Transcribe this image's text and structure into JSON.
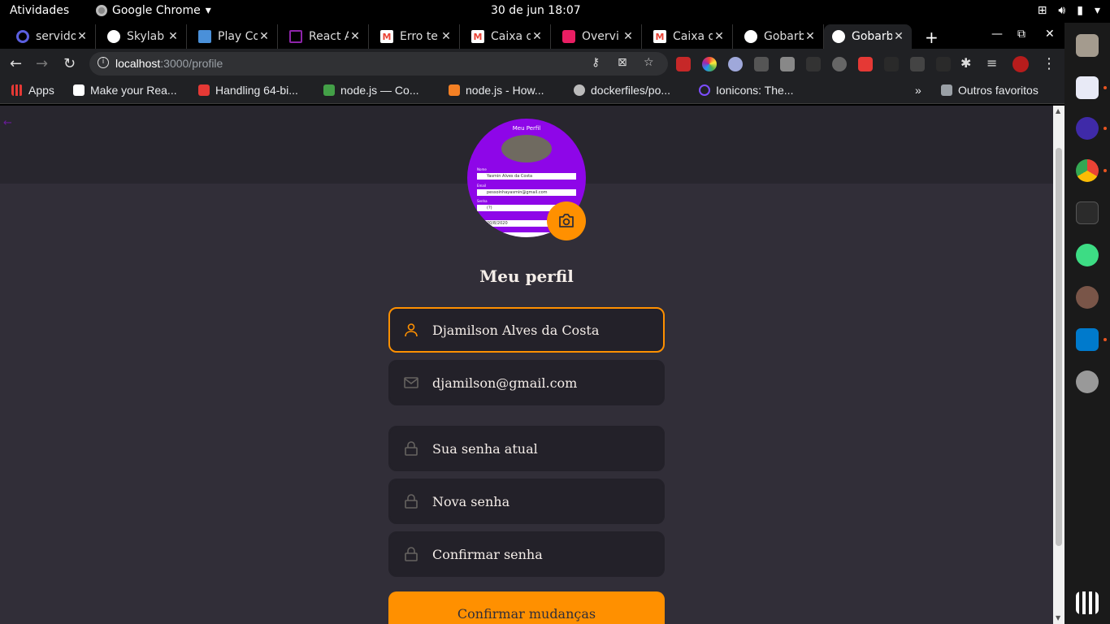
{
  "system": {
    "activities": "Atividades",
    "app_name": "Google Chrome",
    "clock": "30 de jun  18:07"
  },
  "tabs": [
    {
      "title": "servido",
      "color": "#5b5fe0"
    },
    {
      "title": "Skylab",
      "color": "#ffffff"
    },
    {
      "title": "Play Co",
      "color": "#4a90d9"
    },
    {
      "title": "React A",
      "color": "#8e24aa"
    },
    {
      "title": "Erro te",
      "color": "#ea4335"
    },
    {
      "title": "Caixa d",
      "color": "#ea4335"
    },
    {
      "title": "Overvi",
      "color": "#e91e63"
    },
    {
      "title": "Caixa d",
      "color": "#ea4335"
    },
    {
      "title": "Gobarb",
      "color": "#ffffff"
    },
    {
      "title": "Gobarb",
      "color": "#ffffff"
    }
  ],
  "omnibox": {
    "host": "localhost",
    "path": ":3000/profile"
  },
  "bookmarks": [
    {
      "label": "Apps",
      "color": "#e53935"
    },
    {
      "label": "Make your Rea...",
      "color": "#ffffff"
    },
    {
      "label": "Handling 64-bi...",
      "color": "#e53935"
    },
    {
      "label": "node.js — Co...",
      "color": "#43a047"
    },
    {
      "label": "node.js - How...",
      "color": "#f48024"
    },
    {
      "label": "dockerfiles/po...",
      "color": "#bbbbbb"
    },
    {
      "label": "Ionicons: The...",
      "color": "#7c4dff"
    }
  ],
  "other_bookmarks": "Outros favoritos",
  "avatar_preview": {
    "title": "Meu Perfil",
    "name": "Yasmin Alves da Costa",
    "email": "pessoinhayasmin@gmail.com",
    "pass": "(?)",
    "date": "20/8/2020"
  },
  "profile": {
    "title": "Meu perfil",
    "name_value": "Djamilson Alves da Costa",
    "email_value": "djamilson@gmail.com",
    "old_password_placeholder": "Sua senha atual",
    "new_password_placeholder": "Nova senha",
    "confirm_password_placeholder": "Confirmar senha",
    "submit_label": "Confirmar mudanças"
  },
  "colors": {
    "accent": "#ff9000",
    "background": "#312e38",
    "input": "#232129",
    "text": "#f4ede8"
  },
  "icons": [
    "user-icon",
    "mail-icon",
    "lock-icon",
    "camera-icon"
  ]
}
